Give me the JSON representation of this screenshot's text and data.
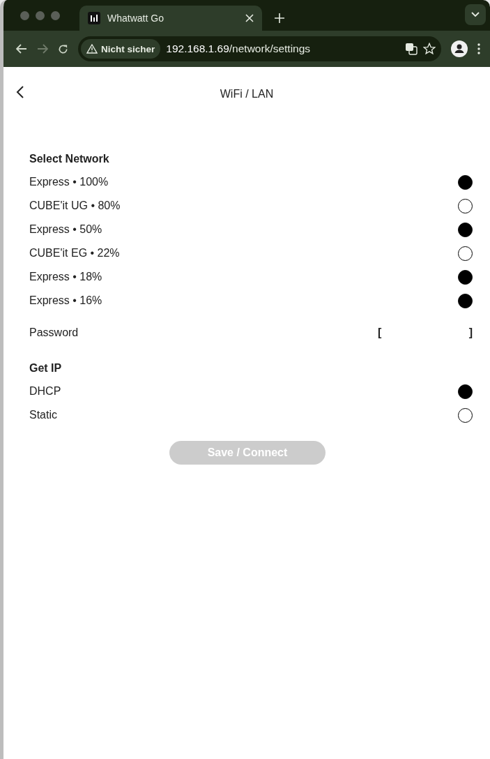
{
  "browser": {
    "tab_title": "Whatwatt Go",
    "security_label": "Nicht sicher",
    "url_host": "192.168.1.69",
    "url_path": "/network/settings"
  },
  "page": {
    "title": "WiFi / LAN"
  },
  "networks": {
    "heading": "Select Network",
    "items": [
      {
        "label": "Express • 100%",
        "selected": true
      },
      {
        "label": "CUBE'it UG • 80%",
        "selected": false
      },
      {
        "label": "Express • 50%",
        "selected": true
      },
      {
        "label": "CUBE'it EG • 22%",
        "selected": false
      },
      {
        "label": "Express • 18%",
        "selected": true
      },
      {
        "label": "Express • 16%",
        "selected": true
      }
    ]
  },
  "password": {
    "label": "Password",
    "bracket_left": "[",
    "bracket_right": "]"
  },
  "get_ip": {
    "heading": "Get IP",
    "items": [
      {
        "label": "DHCP",
        "selected": true
      },
      {
        "label": "Static",
        "selected": false
      }
    ]
  },
  "save_button": {
    "label": "Save / Connect",
    "disabled": true
  }
}
